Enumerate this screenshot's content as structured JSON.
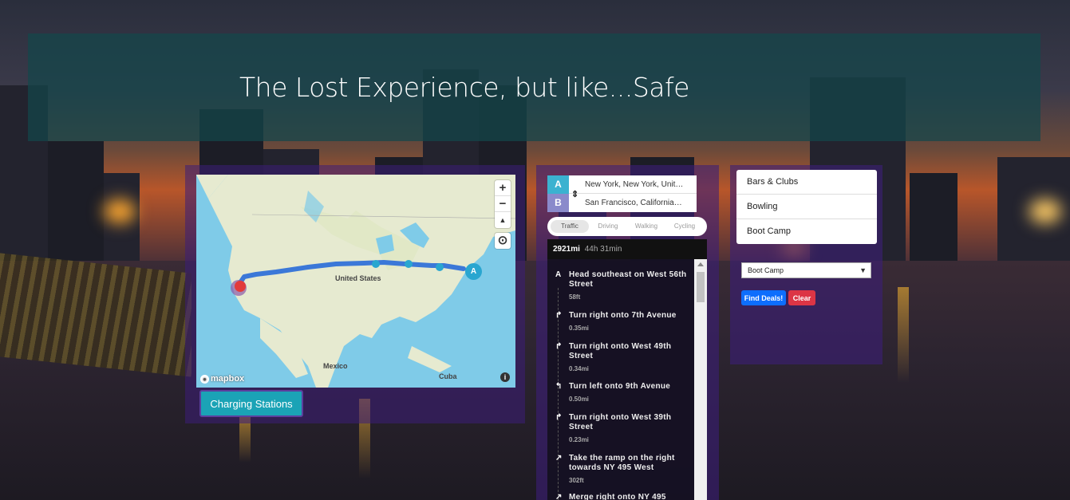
{
  "hero": {
    "title": "The Lost Experience, but like...Safe"
  },
  "map": {
    "labels": {
      "country_us": "United States",
      "country_mx": "Mexico",
      "country_cu": "Cuba"
    },
    "attribution": "mapbox",
    "zoom_in": "+",
    "zoom_out": "−",
    "compass": "▲",
    "locate": "⊙",
    "info": "i",
    "marker_a": "A",
    "route_color": "#3b78d8",
    "marker_color": "#29a6d0"
  },
  "charging_button": {
    "label": "Charging Stations"
  },
  "directions": {
    "origin_letter": "A",
    "destination_letter": "B",
    "origin": "New York, New York, United States",
    "destination": "San Francisco, California, United States",
    "modes": [
      "Traffic",
      "Driving",
      "Walking",
      "Cycling"
    ],
    "active_mode": "Traffic",
    "summary": {
      "distance": "2921mi",
      "duration": "44h 31min"
    },
    "steps": [
      {
        "icon": "A",
        "text": "Head southeast on West 56th Street",
        "dist": "58ft"
      },
      {
        "icon": "↱",
        "text": "Turn right onto 7th Avenue",
        "dist": "0.35mi"
      },
      {
        "icon": "↱",
        "text": "Turn right onto West 49th Street",
        "dist": "0.34mi"
      },
      {
        "icon": "↰",
        "text": "Turn left onto 9th Avenue",
        "dist": "0.50mi"
      },
      {
        "icon": "↱",
        "text": "Turn right onto West 39th Street",
        "dist": "0.23mi"
      },
      {
        "icon": "↗",
        "text": "Take the ramp on the right towards NY 495 West",
        "dist": "302ft"
      },
      {
        "icon": "↗",
        "text": "Merge right onto NY 495",
        "dist": ""
      }
    ]
  },
  "deals": {
    "categories": [
      "Bars & Clubs",
      "Bowling",
      "Boot Camp"
    ],
    "selected": "Boot Camp",
    "find_label": "Find Deals!",
    "clear_label": "Clear"
  }
}
